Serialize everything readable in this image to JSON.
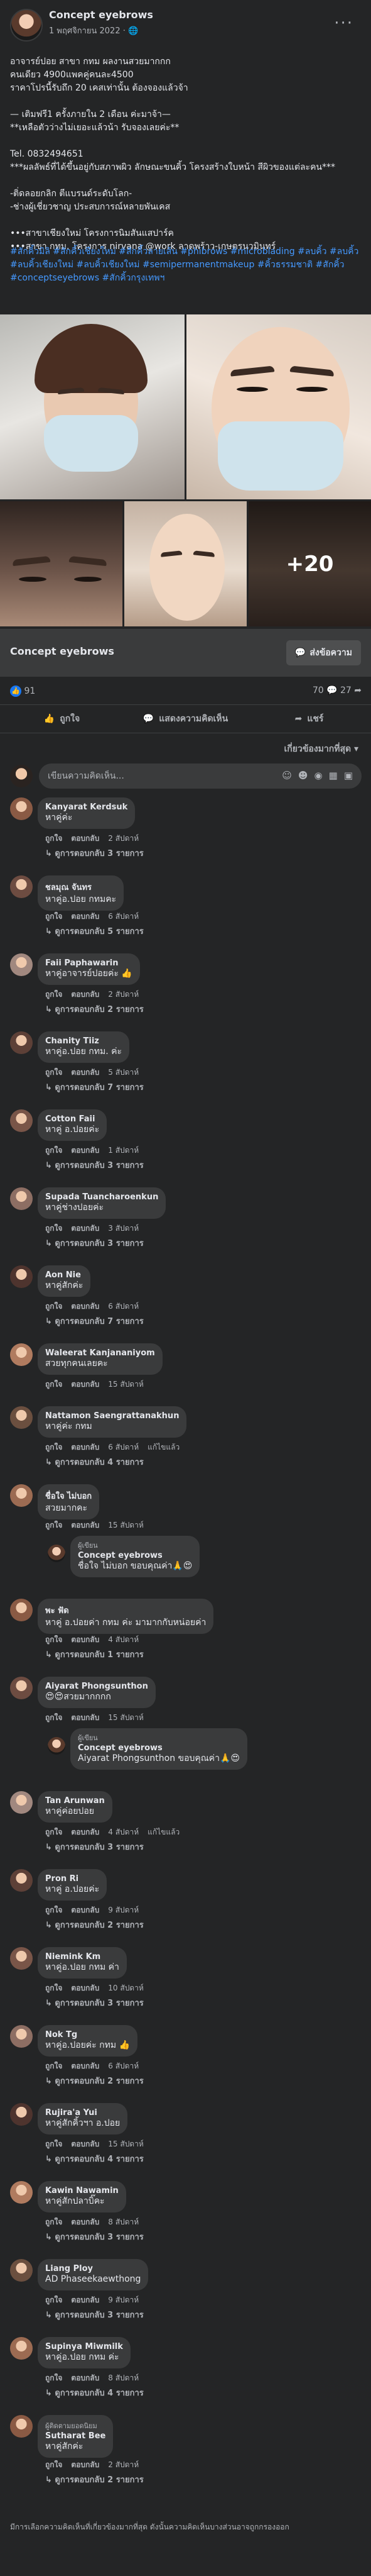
{
  "post": {
    "page_name": "Concept eyebrows",
    "date": "1 พฤศจิกายน 2022",
    "privacy_icon": "globe-icon",
    "text": "อาจารย์ปอย สาขา กทม ผลงานสวยมากกก\nคนเดียว 4900แพคคู่คนละ4500\nราคาโปรนี้รับถึก 20 เคสเท่านั้น ต้องจองแล้วจ้า\n\n— เติมฟรี1 ครั้งภายใน 2 เดือน ค่ะมาจ้า—\n**เหลือตัวว่างไม่เยอะแล้วน้า รับจองเลยค่ะ**\n\n  Tel. 0832494651\n***ผลลัพธ์ที่ได้ขึ้นอยู่กับสภาพผิว ลักษณะขนคิ้ว โครงสร้างใบหน้า สีผิวของแต่ละคน***\n\n-ติ่ดลอยกลิก ตีแบรนด์ระดับโลก-\n-ช่างผู้เชี่ยวชาญ ประสบการณ์หลายพันเคส\n\n•••สาขาเชียงใหม่  โครงการนิมสันแสปาร์ค\n•••สาขา กทม.  โครงการ nirvana @work ลาดพร้าว-เกษตรนวมินทร์",
    "hashtags": "#สักคิ้วมิลิ #สักคิ้วเชียงใหม่ #สักคิ้วลายเส้น #phibrows #microblading #ลบคิ้ว #ลบคิ้ว #ลบคิ้วเชียงใหม่ #ลบคิ้วเชียงใหม่ #semipermanentmakeup #คิ้วธรรมชาติ #สักคิ้ว #conceptseyebrows #สักคิ้วกรุงเทพฯ",
    "more_photos": "+20",
    "link_title": "Concept eyebrows",
    "message_button": "ส่งข้อความ",
    "reaction_count": "91",
    "comment_count": "70",
    "share_count": "27",
    "actions": {
      "like": "ถูกใจ",
      "comment": "แสดงความคิดเห็น",
      "share": "แชร์"
    },
    "sort_label": "เกี่ยวข้องมากที่สุด",
    "comment_placeholder": "เขียนความคิดเห็น...",
    "footer": "มีการเลือกความคิดเห็นที่เกี่ยวข้องมากที่สุด ดังนั้นความคิดเห็นบางส่วนอาจถูกกรองออก"
  },
  "labels": {
    "like": "ถูกใจ",
    "reply": "ตอบกลับ",
    "edited": "แก้ไขแล้ว"
  },
  "comments": [
    {
      "name": "Kanyarat Kerdsuk",
      "text": "หาคู่ค่ะ",
      "time": "2 สัปดาห์",
      "replies": "ดูการตอบกลับ 3 รายการ"
    },
    {
      "name": "ชลมุณ จันทร",
      "text": "หาคู่อ.ปอย กทมคะ",
      "time": "6 สัปดาห์",
      "replies": "ดูการตอบกลับ 5 รายการ"
    },
    {
      "name": "Faii Paphawarin",
      "text": "หาคู่อาจารย์ปอยค่ะ 👍",
      "time": "2 สัปดาห์",
      "replies": "ดูการตอบกลับ 2 รายการ"
    },
    {
      "name": "Chanity Tiiz",
      "text": "หาคู่อ.ปอย กทม. ค่ะ",
      "time": "5 สัปดาห์",
      "replies": "ดูการตอบกลับ 7 รายการ"
    },
    {
      "name": "Cotton Faii",
      "text": "หาคู่ อ.ปอยค่ะ",
      "time": "1 สัปดาห์",
      "replies": "ดูการตอบกลับ 3 รายการ"
    },
    {
      "name": "Supada Tuancharoenkun",
      "text": "หาคู่ช่างปอยค่ะ",
      "time": "3 สัปดาห์",
      "replies": "ดูการตอบกลับ 3 รายการ"
    },
    {
      "name": "Aon Nie",
      "text": "หาคู่สักค่ะ",
      "time": "6 สัปดาห์",
      "replies": "ดูการตอบกลับ 7 รายการ"
    },
    {
      "name": "Waleerat Kanjananiyom",
      "text": "สวยทุกคนเลยคะ",
      "time": "15 สัปดาห์"
    },
    {
      "name": "Nattamon Saengrattanakhun",
      "text": "หาคู่ค่ะ กทม",
      "time": "6 สัปดาห์",
      "edited": true,
      "replies": "ดูการตอบกลับ 4 รายการ"
    },
    {
      "name": "ชื่อใจ ไม่บอก",
      "text": "สวยมากคะ",
      "time": "15 สัปดาห์",
      "reply": {
        "author": "ผู้เขียน",
        "name": "Concept eyebrows",
        "text": "ชื่อใจ ไม่บอก ขอบคุณค่า🙏😍"
      }
    },
    {
      "name": "พะ ฟัด",
      "text": "หาคู่ อ.ปอยค่า กทม ค่ะ มามากกับหน่อยค่า",
      "time": "4 สัปดาห์",
      "replies": "ดูการตอบกลับ 1 รายการ"
    },
    {
      "name": "Aiyarat Phongsunthon",
      "text": "😍😍สวยมากกกก",
      "time": "15 สัปดาห์",
      "reply": {
        "author": "ผู้เขียน",
        "name": "Concept eyebrows",
        "text": "Aiyarat Phongsunthon ขอบคุณค่า🙏😍"
      }
    },
    {
      "name": "Tan Arunwan",
      "text": "หาคู่ค่อยปอย",
      "time": "4 สัปดาห์",
      "edited": true,
      "replies": "ดูการตอบกลับ 3 รายการ"
    },
    {
      "name": "Pron Ri",
      "text": "หาคู่ อ.ปอยค่ะ",
      "time": "9 สัปดาห์",
      "replies": "ดูการตอบกลับ 2 รายการ"
    },
    {
      "name": "Niemink Km",
      "text": "หาคู่อ.ปอย กทม ค่า",
      "time": "10 สัปดาห์",
      "replies": "ดูการตอบกลับ 3 รายการ"
    },
    {
      "name": "Nok Tg",
      "text": "หาคู่อ.ปอยค่ะ กทม 👍",
      "time": "6 สัปดาห์",
      "replies": "ดูการตอบกลับ 2 รายการ"
    },
    {
      "name": "Rujira'a Yui",
      "text": "หาคู่สักคิ้วฯา อ.ปอย",
      "time": "15 สัปดาห์",
      "replies": "ดูการตอบกลับ 4 รายการ"
    },
    {
      "name": "Kawin Nawamin",
      "text": "หาคู่สักปลาบิ๊คะ",
      "time": "8 สัปดาห์",
      "replies": "ดูการตอบกลับ 3 รายการ"
    },
    {
      "name": "Liang Ploy",
      "text": "AD Phaseekaewthong",
      "time": "9 สัปดาห์",
      "replies": "ดูการตอบกลับ 3 รายการ"
    },
    {
      "name": "Supinya Miwmilk",
      "text": "หาคู่อ.ปอย กทม ค่ะ",
      "time": "8 สัปดาห์",
      "replies": "ดูการตอบกลับ 4 รายการ"
    },
    {
      "name": "Sutharat Bee",
      "text": "หาคู่สักค่ะ",
      "time": "2 สัปดาห์",
      "badge": "ผู้ติดตามยอดนิยม",
      "replies": "ดูการตอบกลับ 2 รายการ"
    }
  ]
}
